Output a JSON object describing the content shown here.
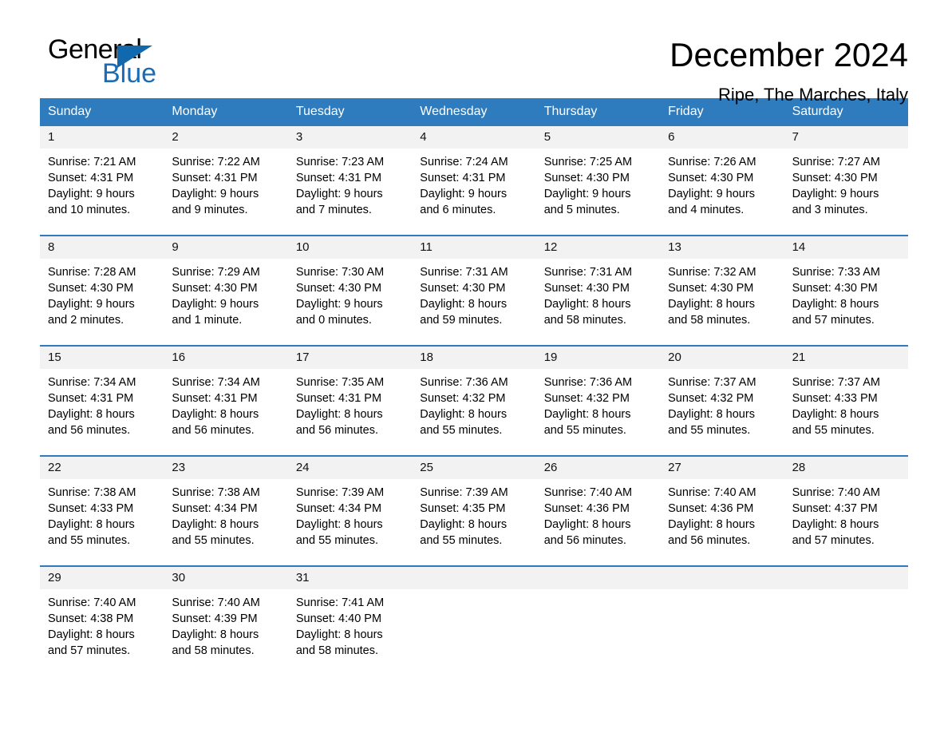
{
  "brand": {
    "name_top": "General",
    "name_bottom": "Blue",
    "accent_color": "#1268ad",
    "triangle_icon": "triangle-icon"
  },
  "header": {
    "title": "December 2024",
    "location": "Ripe, The Marches, Italy"
  },
  "colors": {
    "header_blue": "#2e7cbe",
    "daynum_band": "#f2f2f2",
    "page_background": "#ffffff",
    "text": "#000000"
  },
  "weekdays": [
    "Sunday",
    "Monday",
    "Tuesday",
    "Wednesday",
    "Thursday",
    "Friday",
    "Saturday"
  ],
  "weeks": [
    [
      {
        "day": "1",
        "lines": [
          "Sunrise: 7:21 AM",
          "Sunset: 4:31 PM",
          "Daylight: 9 hours",
          "and 10 minutes."
        ]
      },
      {
        "day": "2",
        "lines": [
          "Sunrise: 7:22 AM",
          "Sunset: 4:31 PM",
          "Daylight: 9 hours",
          "and 9 minutes."
        ]
      },
      {
        "day": "3",
        "lines": [
          "Sunrise: 7:23 AM",
          "Sunset: 4:31 PM",
          "Daylight: 9 hours",
          "and 7 minutes."
        ]
      },
      {
        "day": "4",
        "lines": [
          "Sunrise: 7:24 AM",
          "Sunset: 4:31 PM",
          "Daylight: 9 hours",
          "and 6 minutes."
        ]
      },
      {
        "day": "5",
        "lines": [
          "Sunrise: 7:25 AM",
          "Sunset: 4:30 PM",
          "Daylight: 9 hours",
          "and 5 minutes."
        ]
      },
      {
        "day": "6",
        "lines": [
          "Sunrise: 7:26 AM",
          "Sunset: 4:30 PM",
          "Daylight: 9 hours",
          "and 4 minutes."
        ]
      },
      {
        "day": "7",
        "lines": [
          "Sunrise: 7:27 AM",
          "Sunset: 4:30 PM",
          "Daylight: 9 hours",
          "and 3 minutes."
        ]
      }
    ],
    [
      {
        "day": "8",
        "lines": [
          "Sunrise: 7:28 AM",
          "Sunset: 4:30 PM",
          "Daylight: 9 hours",
          "and 2 minutes."
        ]
      },
      {
        "day": "9",
        "lines": [
          "Sunrise: 7:29 AM",
          "Sunset: 4:30 PM",
          "Daylight: 9 hours",
          "and 1 minute."
        ]
      },
      {
        "day": "10",
        "lines": [
          "Sunrise: 7:30 AM",
          "Sunset: 4:30 PM",
          "Daylight: 9 hours",
          "and 0 minutes."
        ]
      },
      {
        "day": "11",
        "lines": [
          "Sunrise: 7:31 AM",
          "Sunset: 4:30 PM",
          "Daylight: 8 hours",
          "and 59 minutes."
        ]
      },
      {
        "day": "12",
        "lines": [
          "Sunrise: 7:31 AM",
          "Sunset: 4:30 PM",
          "Daylight: 8 hours",
          "and 58 minutes."
        ]
      },
      {
        "day": "13",
        "lines": [
          "Sunrise: 7:32 AM",
          "Sunset: 4:30 PM",
          "Daylight: 8 hours",
          "and 58 minutes."
        ]
      },
      {
        "day": "14",
        "lines": [
          "Sunrise: 7:33 AM",
          "Sunset: 4:30 PM",
          "Daylight: 8 hours",
          "and 57 minutes."
        ]
      }
    ],
    [
      {
        "day": "15",
        "lines": [
          "Sunrise: 7:34 AM",
          "Sunset: 4:31 PM",
          "Daylight: 8 hours",
          "and 56 minutes."
        ]
      },
      {
        "day": "16",
        "lines": [
          "Sunrise: 7:34 AM",
          "Sunset: 4:31 PM",
          "Daylight: 8 hours",
          "and 56 minutes."
        ]
      },
      {
        "day": "17",
        "lines": [
          "Sunrise: 7:35 AM",
          "Sunset: 4:31 PM",
          "Daylight: 8 hours",
          "and 56 minutes."
        ]
      },
      {
        "day": "18",
        "lines": [
          "Sunrise: 7:36 AM",
          "Sunset: 4:32 PM",
          "Daylight: 8 hours",
          "and 55 minutes."
        ]
      },
      {
        "day": "19",
        "lines": [
          "Sunrise: 7:36 AM",
          "Sunset: 4:32 PM",
          "Daylight: 8 hours",
          "and 55 minutes."
        ]
      },
      {
        "day": "20",
        "lines": [
          "Sunrise: 7:37 AM",
          "Sunset: 4:32 PM",
          "Daylight: 8 hours",
          "and 55 minutes."
        ]
      },
      {
        "day": "21",
        "lines": [
          "Sunrise: 7:37 AM",
          "Sunset: 4:33 PM",
          "Daylight: 8 hours",
          "and 55 minutes."
        ]
      }
    ],
    [
      {
        "day": "22",
        "lines": [
          "Sunrise: 7:38 AM",
          "Sunset: 4:33 PM",
          "Daylight: 8 hours",
          "and 55 minutes."
        ]
      },
      {
        "day": "23",
        "lines": [
          "Sunrise: 7:38 AM",
          "Sunset: 4:34 PM",
          "Daylight: 8 hours",
          "and 55 minutes."
        ]
      },
      {
        "day": "24",
        "lines": [
          "Sunrise: 7:39 AM",
          "Sunset: 4:34 PM",
          "Daylight: 8 hours",
          "and 55 minutes."
        ]
      },
      {
        "day": "25",
        "lines": [
          "Sunrise: 7:39 AM",
          "Sunset: 4:35 PM",
          "Daylight: 8 hours",
          "and 55 minutes."
        ]
      },
      {
        "day": "26",
        "lines": [
          "Sunrise: 7:40 AM",
          "Sunset: 4:36 PM",
          "Daylight: 8 hours",
          "and 56 minutes."
        ]
      },
      {
        "day": "27",
        "lines": [
          "Sunrise: 7:40 AM",
          "Sunset: 4:36 PM",
          "Daylight: 8 hours",
          "and 56 minutes."
        ]
      },
      {
        "day": "28",
        "lines": [
          "Sunrise: 7:40 AM",
          "Sunset: 4:37 PM",
          "Daylight: 8 hours",
          "and 57 minutes."
        ]
      }
    ],
    [
      {
        "day": "29",
        "lines": [
          "Sunrise: 7:40 AM",
          "Sunset: 4:38 PM",
          "Daylight: 8 hours",
          "and 57 minutes."
        ]
      },
      {
        "day": "30",
        "lines": [
          "Sunrise: 7:40 AM",
          "Sunset: 4:39 PM",
          "Daylight: 8 hours",
          "and 58 minutes."
        ]
      },
      {
        "day": "31",
        "lines": [
          "Sunrise: 7:41 AM",
          "Sunset: 4:40 PM",
          "Daylight: 8 hours",
          "and 58 minutes."
        ]
      },
      {
        "day": "",
        "lines": []
      },
      {
        "day": "",
        "lines": []
      },
      {
        "day": "",
        "lines": []
      },
      {
        "day": "",
        "lines": []
      }
    ]
  ]
}
